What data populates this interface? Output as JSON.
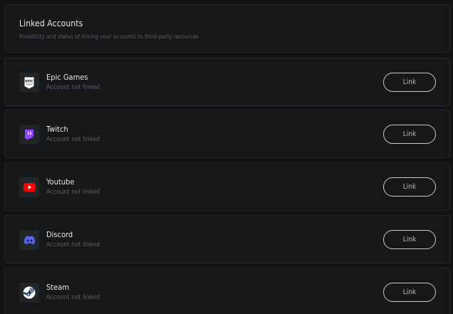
{
  "header": {
    "title": "Linked Accounts",
    "subtitle": "Possibility and status of linking your accounts to third-party resources"
  },
  "accounts": [
    {
      "name": "Epic Games",
      "status": "Account not linked",
      "button": "Link",
      "icon": "epic-games-icon",
      "color": "#ffffff"
    },
    {
      "name": "Twitch",
      "status": "Account not linked",
      "button": "Link",
      "icon": "twitch-icon",
      "color": "#9146ff"
    },
    {
      "name": "Youtube",
      "status": "Account not linked",
      "button": "Link",
      "icon": "youtube-icon",
      "color": "#ff0000"
    },
    {
      "name": "Discord",
      "status": "Account not linked",
      "button": "Link",
      "icon": "discord-icon",
      "color": "#5865f2"
    },
    {
      "name": "Steam",
      "status": "Account not linked",
      "button": "Link",
      "icon": "steam-icon",
      "color": "#1b2838"
    }
  ]
}
